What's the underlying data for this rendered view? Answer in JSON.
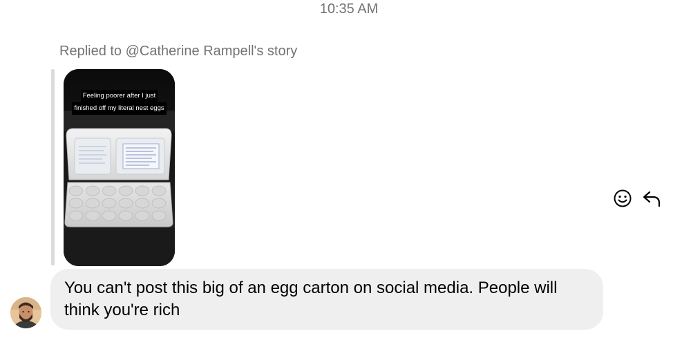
{
  "header": {
    "timestamp": "10:35 AM"
  },
  "reply": {
    "context_text": "Replied to @Catherine Rampell's story",
    "story_caption_line1": "Feeling poorer after I just",
    "story_caption_line2": "finished off my literal nest eggs"
  },
  "actions": {
    "react_icon": "smiley-icon",
    "reply_icon": "reply-arrow-icon"
  },
  "message": {
    "text": "You can't post this big of an egg carton on social media. People will think you're rich"
  },
  "colors": {
    "bubble": "#efefef",
    "meta_text": "#737373",
    "quote_bar": "#dbdbdb"
  }
}
